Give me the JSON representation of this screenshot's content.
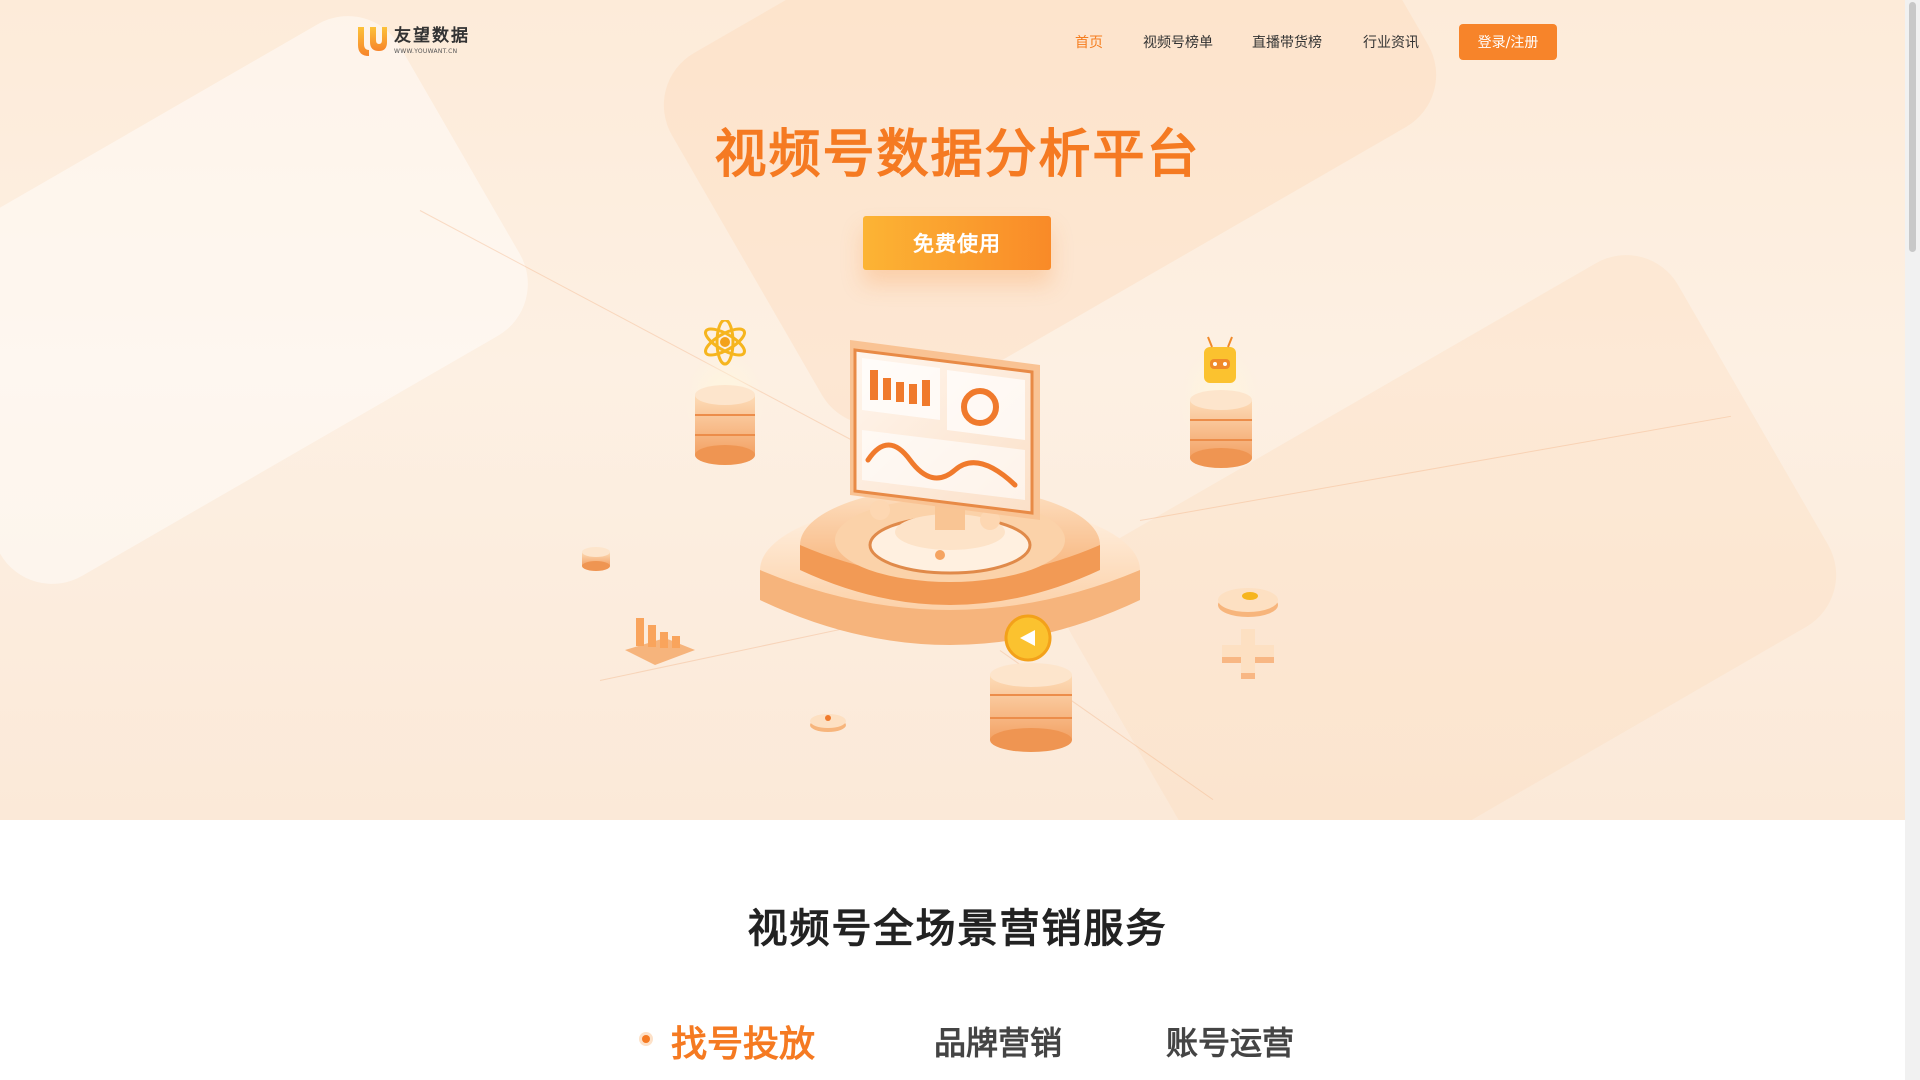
{
  "header": {
    "logo_name": "友望数据",
    "logo_url": "WWW.YOUWANT.CN",
    "nav": [
      {
        "label": "首页",
        "active": true
      },
      {
        "label": "视频号榜单",
        "active": false
      },
      {
        "label": "直播带货榜",
        "active": false
      },
      {
        "label": "行业资讯",
        "active": false
      }
    ],
    "login_label": "登录/注册"
  },
  "hero": {
    "title": "视频号数据分析平台",
    "cta_label": "免费使用"
  },
  "services": {
    "title": "视频号全场景营销服务",
    "tabs": [
      {
        "label": "找号投放",
        "active": true
      },
      {
        "label": "品牌营销",
        "active": false
      },
      {
        "label": "账号运营",
        "active": false
      }
    ]
  },
  "colors": {
    "accent": "#f57a22",
    "button": "#f7842a",
    "hero_bg": "#fdebd9"
  }
}
